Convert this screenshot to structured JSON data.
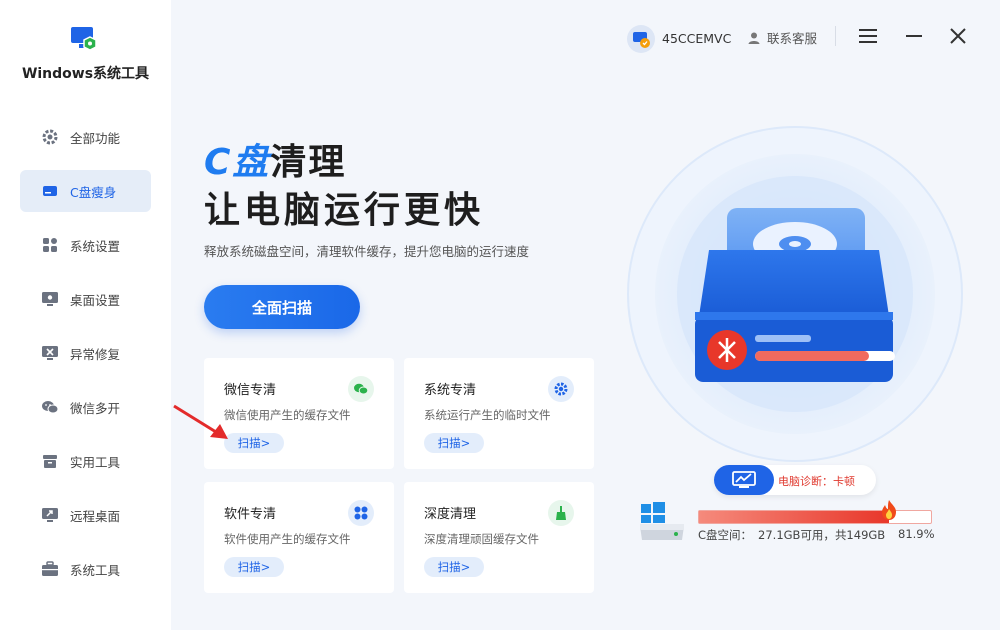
{
  "app": {
    "title": "Windows系统工具"
  },
  "sidebar": {
    "items": [
      {
        "label": "全部功能",
        "icon": "gear-icon",
        "active": false
      },
      {
        "label": "C盘瘦身",
        "icon": "disk-icon",
        "active": true
      },
      {
        "label": "系统设置",
        "icon": "grid-icon",
        "active": false
      },
      {
        "label": "桌面设置",
        "icon": "monitor-gear-icon",
        "active": false
      },
      {
        "label": "异常修复",
        "icon": "wrench-monitor-icon",
        "active": false
      },
      {
        "label": "微信多开",
        "icon": "wechat-icon",
        "active": false
      },
      {
        "label": "实用工具",
        "icon": "box-icon",
        "active": false
      },
      {
        "label": "远程桌面",
        "icon": "remote-desktop-icon",
        "active": false
      },
      {
        "label": "系统工具",
        "icon": "toolbox-icon",
        "active": false
      }
    ]
  },
  "header": {
    "user": "45CCEMVC",
    "support": "联系客服"
  },
  "hero": {
    "title_accent": "C盘",
    "title_rest": "清理",
    "title_line2": "让电脑运行更快",
    "subtitle": "释放系统磁盘空间，清理软件缓存，提升您电脑的运行速度",
    "scan_all": "全面扫描"
  },
  "cards": [
    {
      "title": "微信专清",
      "desc": "微信使用产生的缓存文件",
      "button": "扫描>",
      "icon": "wechat-icon",
      "icon_color": "#2bb24c"
    },
    {
      "title": "系统专清",
      "desc": "系统运行产生的临时文件",
      "button": "扫描>",
      "icon": "gear-icon",
      "icon_color": "#1f64e6"
    },
    {
      "title": "软件专清",
      "desc": "软件使用产生的缓存文件",
      "button": "扫描>",
      "icon": "apps-icon",
      "icon_color": "#1f64e6"
    },
    {
      "title": "深度清理",
      "desc": "深度清理顽固缓存文件",
      "button": "扫描>",
      "icon": "broom-icon",
      "icon_color": "#2bb24c"
    }
  ],
  "diagnosis": {
    "text": "电脑诊断：卡顿"
  },
  "disk": {
    "label": "C盘空间：",
    "free": "27.1GB可用，",
    "total": "共149GB",
    "percent": "81.9%",
    "used_fraction": 0.819
  },
  "colors": {
    "accent": "#1f64e6",
    "danger": "#e8372a",
    "green": "#2bb24c"
  }
}
